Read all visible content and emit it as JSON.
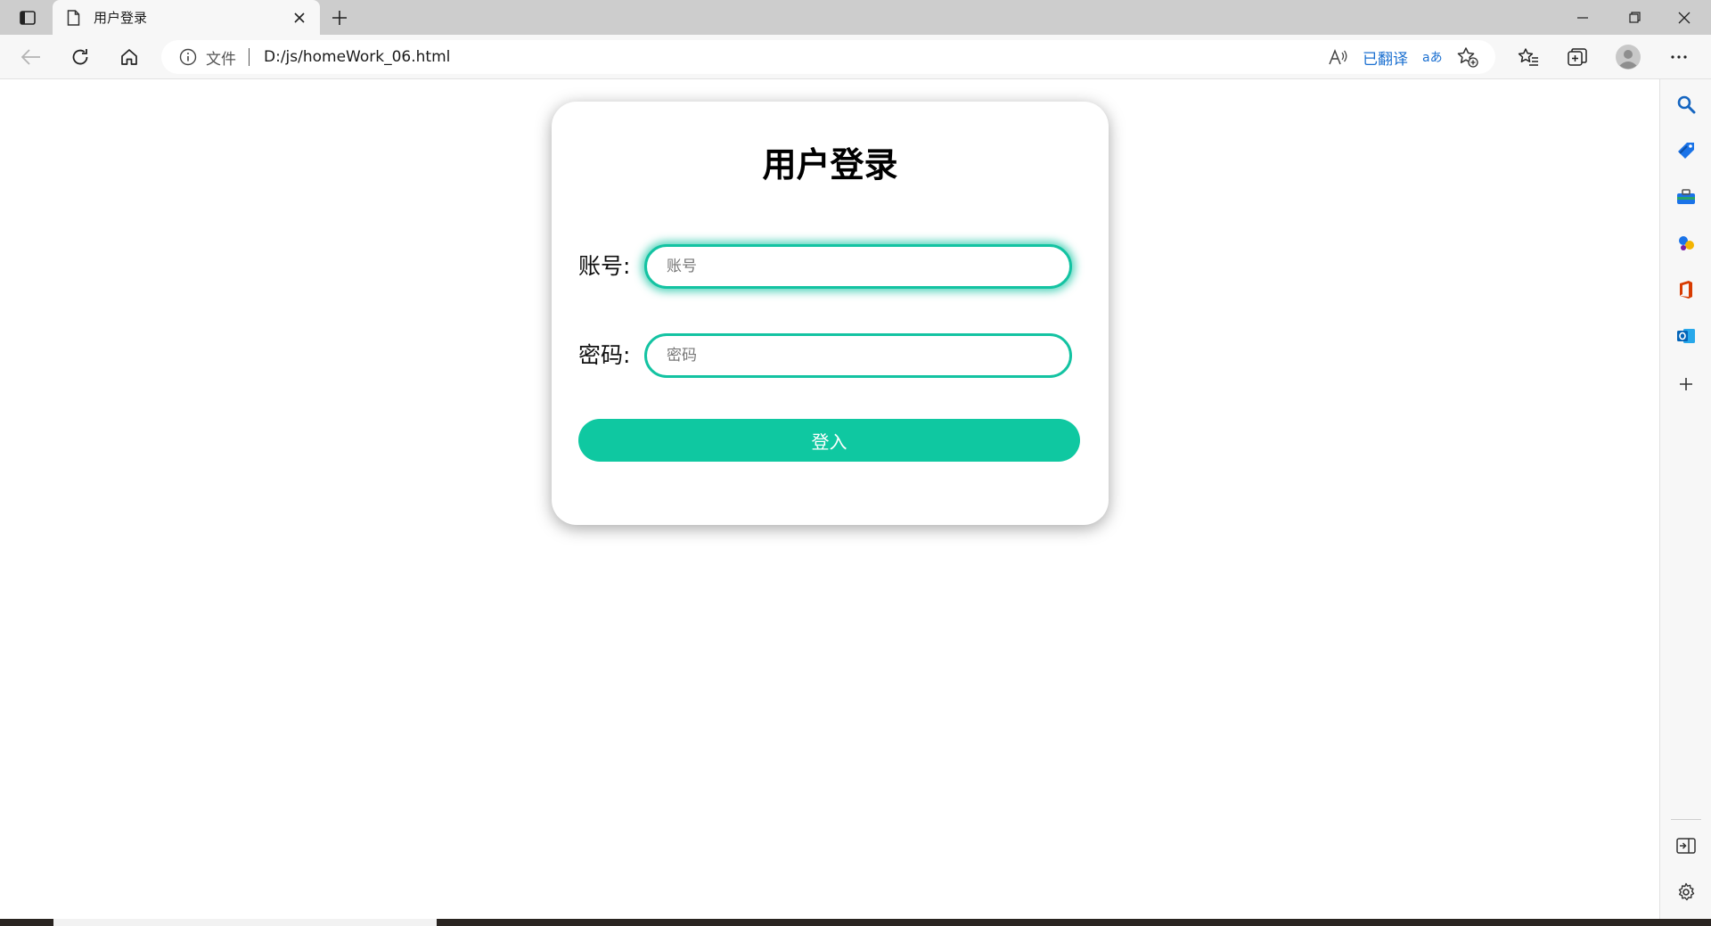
{
  "browser": {
    "tab": {
      "title": "用户登录"
    },
    "address": {
      "scheme_label": "文件",
      "url": "D:/js/homeWork_06.html",
      "translated_label": "已翻译"
    },
    "icons": {
      "tab_actions": "tab-actions-icon",
      "page": "page-icon",
      "close": "close-icon",
      "new_tab": "plus-icon",
      "back": "back-arrow-icon",
      "refresh": "refresh-icon",
      "home": "home-icon",
      "info": "info-icon",
      "read_aloud": "read-aloud-icon",
      "translate": "translate-icon",
      "add_favorite": "add-favorite-icon",
      "favorites": "favorites-icon",
      "collections": "collections-icon",
      "profile": "profile-avatar",
      "more": "more-icon"
    },
    "sidebar": [
      "search-icon",
      "shopping-tag-icon",
      "tools-icon",
      "games-icon",
      "office-icon",
      "outlook-icon",
      "add-icon",
      "hide-sidebar-icon",
      "settings-icon"
    ]
  },
  "login": {
    "title": "用户登录",
    "account": {
      "label": "账号:",
      "placeholder": "账号",
      "value": ""
    },
    "password": {
      "label": "密码:",
      "placeholder": "密码",
      "value": ""
    },
    "submit_label": "登入"
  },
  "colors": {
    "accent": "#0fc8a1",
    "input_border": "#13c3a2",
    "translated_link": "#1a6fd0"
  }
}
